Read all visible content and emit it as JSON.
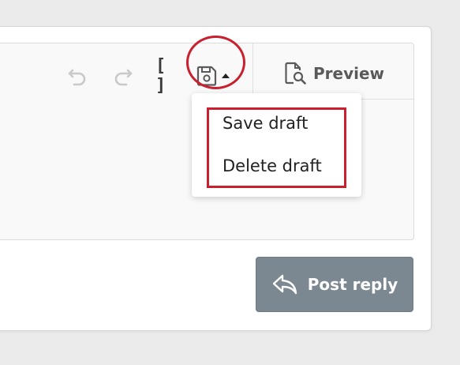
{
  "toolbar": {
    "undo_icon": "undo-icon",
    "redo_icon": "redo-icon",
    "bbcode_label": "[ ]",
    "draft_icon": "save-icon",
    "draft_caret_icon": "caret-up-icon",
    "preview_label": "Preview",
    "preview_icon": "preview-icon"
  },
  "draft_menu": {
    "items": [
      {
        "label": "Save draft"
      },
      {
        "label": "Delete draft"
      }
    ]
  },
  "footer": {
    "post_reply_label": "Post reply",
    "post_reply_icon": "reply-icon"
  },
  "colors": {
    "highlight": "#c8202e",
    "button_bg": "#7b8791",
    "toolbar_icon": "#5a5a5a",
    "disabled_icon": "#c9c9c9"
  }
}
